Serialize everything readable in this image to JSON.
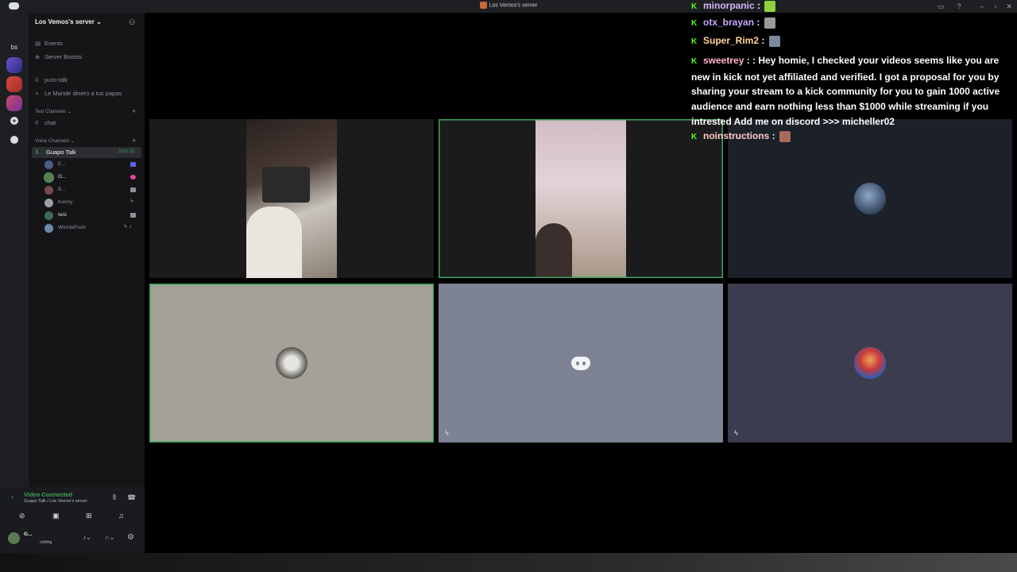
{
  "window": {
    "title": "Los Vemos's server"
  },
  "rail": {
    "dm_label": "bs"
  },
  "server": {
    "name": "Los Vemos's server",
    "events": "Events",
    "boosts": "Server Boosts",
    "channels_top": [
      {
        "label": "puro-talk",
        "kind": "text"
      },
      {
        "label": "Le Mande dinero a tus papas",
        "kind": "voice"
      }
    ],
    "text_category": "Text Channels",
    "text_channels": [
      "chat"
    ],
    "voice_category": "Voice Channels",
    "active_voice": {
      "label": "Guapo Talk",
      "timer": "3:01:15"
    },
    "voice_users": [
      "E...",
      "G...",
      "B...",
      "Kenny",
      "twiz",
      "WinniePooh"
    ]
  },
  "voice_status": {
    "title": "Video Connected",
    "subtitle": "Guapo Talk / Los Vemos's server"
  },
  "user": {
    "name": "G...",
    "status": "chilling"
  },
  "chat": [
    {
      "user": "minorpanic",
      "message": "",
      "name_color": "#d9b3ff"
    },
    {
      "user": "otx_brayan",
      "message": "",
      "name_color": "#c8a8ff"
    },
    {
      "user": "Super_Rim2",
      "message": "",
      "name_color": "#ffd699"
    },
    {
      "user": "sweetrey",
      "message": ": : Hey homie, I checked your videos seems like you are new in kick not yet affiliated and verified. I got a proposal for you by sharing your stream to a kick community for you to gain 1000 active audience and earn nothing less than $1000 while streaming if you intrested Add me on discord >>> micheller02",
      "name_color": "#ffb3d1"
    },
    {
      "user": "noinstructions",
      "message": "",
      "name_color": "#ffcccc"
    }
  ],
  "colors": {
    "speaking": "#3ba55c",
    "kick": "#53fc18",
    "discord": "#5865f2"
  }
}
